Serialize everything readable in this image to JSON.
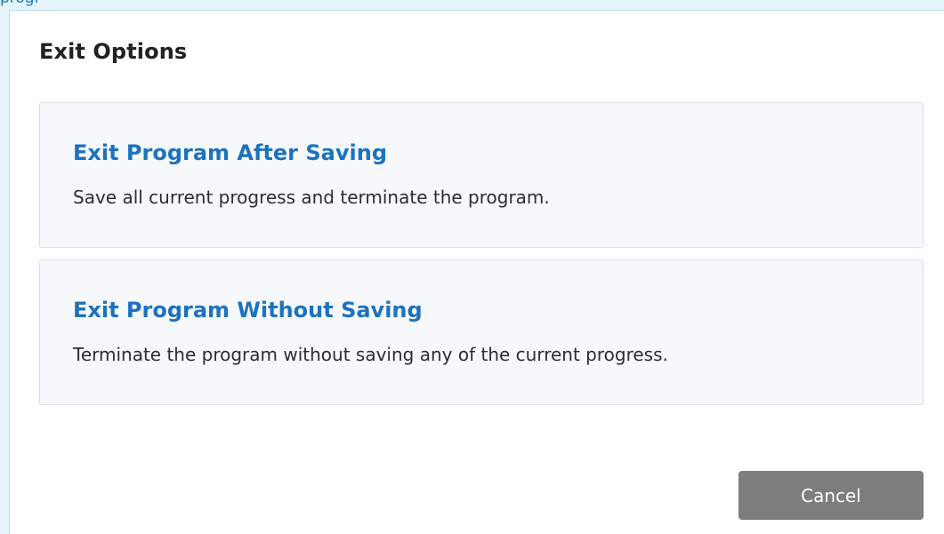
{
  "backdrop": {
    "partial_text": "progr"
  },
  "dialog": {
    "title": "Exit Options",
    "options": [
      {
        "title": "Exit Program After Saving",
        "description": "Save all current progress and terminate the program."
      },
      {
        "title": "Exit Program Without Saving",
        "description": "Terminate the program without saving any of the current progress."
      }
    ],
    "cancel_label": "Cancel"
  },
  "colors": {
    "accent": "#1d72bf",
    "backdrop": "#e6f4fb",
    "cancel_button": "#7d7d7d",
    "card_background": "#f7f8fb"
  }
}
